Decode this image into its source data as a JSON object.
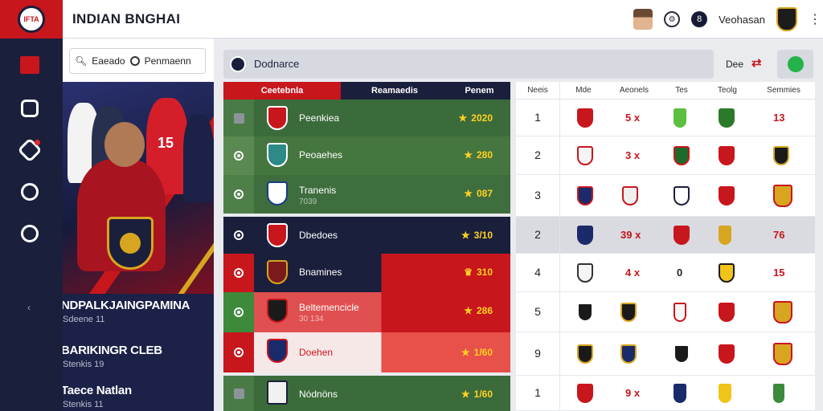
{
  "app": {
    "title": "INDIAN BNGHAI",
    "logo_text": "IFTA"
  },
  "topbar": {
    "user_name": "Veohasan"
  },
  "search": {
    "placeholder": "Eaeado",
    "filter_label": "Penmaenn"
  },
  "clubs": [
    {
      "name": "NDPALKJAINGPAMINA",
      "sub": "Sdeene 11"
    },
    {
      "name": "BARIKINGR CLEB",
      "sub": "Stenkis 19"
    },
    {
      "name": "Taece Natlan",
      "sub": "Stenkis 11"
    }
  ],
  "main": {
    "title": "Dodnarce",
    "right_label": "Dee"
  },
  "left_table": {
    "headers": [
      "Ceetebnla",
      "Reamaedis",
      "Penem"
    ],
    "rows": [
      {
        "name": "Peenkiea",
        "sub": "",
        "rating": "2020"
      },
      {
        "name": "Peoaehes",
        "sub": "",
        "rating": "280"
      },
      {
        "name": "Tranenis",
        "sub": "7039",
        "rating": "087"
      },
      {
        "name": "Dbedoes",
        "sub": "",
        "rating": "3/10"
      },
      {
        "name": "Bnamines",
        "sub": "",
        "rating": "310"
      },
      {
        "name": "Beltemencicle",
        "sub": "30 134",
        "rating": "286"
      },
      {
        "name": "Doehen",
        "sub": "",
        "rating": "1/60"
      },
      {
        "name": "Nódnöns",
        "sub": "",
        "rating": "1/60"
      }
    ]
  },
  "right_table": {
    "headers": [
      "Neeis",
      "Mde",
      "Aeonels",
      "Tes",
      "Teolg",
      "Semmies"
    ],
    "rows": [
      {
        "idx": "1",
        "mde": "",
        "aeonels": "5 x",
        "tes": "",
        "teolg": "",
        "semmies": "13"
      },
      {
        "idx": "2",
        "mde": "",
        "aeonels": "3 x",
        "tes": "",
        "teolg": "",
        "semmies": ""
      },
      {
        "idx": "3",
        "mde": "",
        "aeonels": "",
        "tes": "",
        "teolg": "",
        "semmies": ""
      },
      {
        "idx": "2",
        "mde": "",
        "aeonels": "39 x",
        "tes": "",
        "teolg": "",
        "semmies": "76"
      },
      {
        "idx": "4",
        "mde": "",
        "aeonels": "4 x",
        "tes": "0",
        "teolg": "",
        "semmies": "15"
      },
      {
        "idx": "5",
        "mde": "",
        "aeonels": "",
        "tes": "",
        "teolg": "",
        "semmies": ""
      },
      {
        "idx": "9",
        "mde": "",
        "aeonels": "",
        "tes": "",
        "teolg": "",
        "semmies": ""
      },
      {
        "idx": "1",
        "mde": "",
        "aeonels": "9 x",
        "tes": "",
        "teolg": "",
        "semmies": ""
      }
    ]
  },
  "colors": {
    "navy": "#1a1f3c",
    "red": "#c8161d",
    "green": "#3d6b3a",
    "gold": "#ffd21f"
  }
}
